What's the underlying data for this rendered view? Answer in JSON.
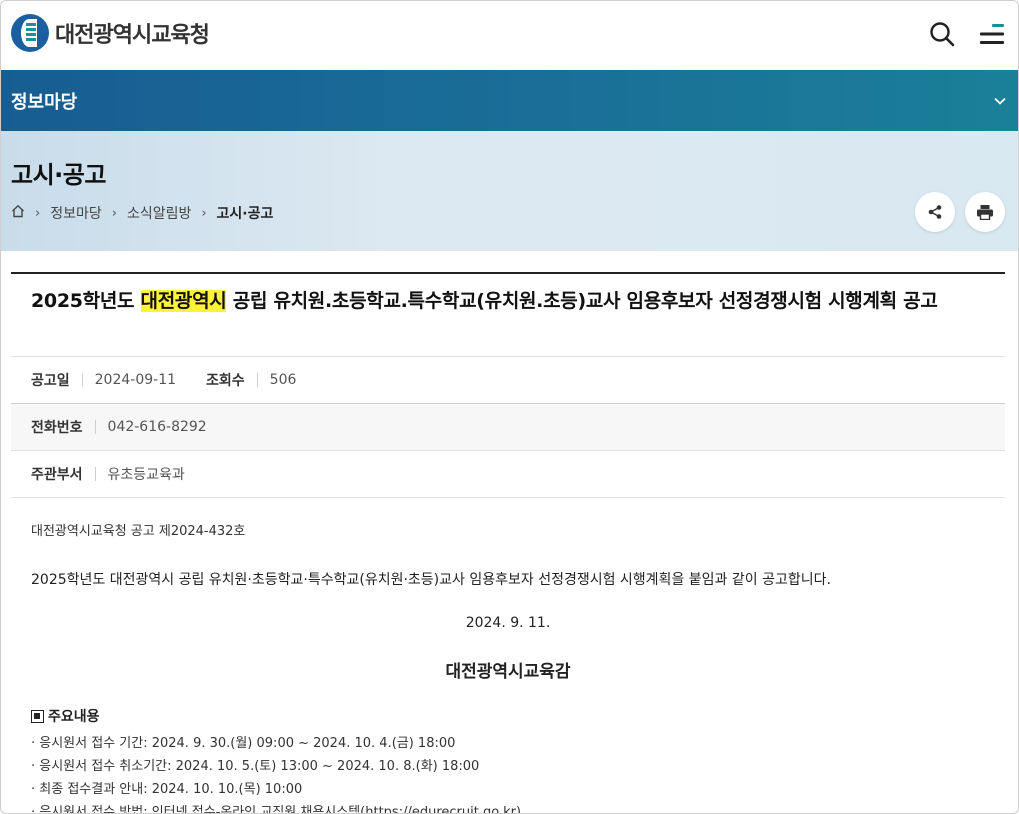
{
  "header": {
    "logo_text": "대전광역시교육청"
  },
  "section": {
    "title": "정보마당"
  },
  "page": {
    "title": "고시·공고",
    "breadcrumb": [
      "정보마당",
      "소식알림방",
      "고시·공고"
    ]
  },
  "post": {
    "title_before": "2025학년도 ",
    "title_highlight": "대전광역시",
    "title_after": " 공립 유치원.초등학교.특수학교(유치원.초등)교사 임용후보자 선정경쟁시험 시행계획 공고",
    "meta": {
      "date_label": "공고일",
      "date_value": "2024-09-11",
      "views_label": "조회수",
      "views_value": "506",
      "phone_label": "전화번호",
      "phone_value": "042-616-8292",
      "dept_label": "주관부서",
      "dept_value": "유초등교육과"
    },
    "body": {
      "notice_no": "대전광역시교육청 공고 제2024-432호",
      "intro": "2025학년도 대전광역시 공립 유치원·초등학교·특수학교(유치원·초등)교사 임용후보자 선정경쟁시험 시행계획을 붙임과 같이 공고합니다.",
      "date": "2024. 9. 11.",
      "issuer": "대전광역시교육감",
      "subhead": "주요내용",
      "items": [
        "· 응시원서 접수 기간: 2024. 9. 30.(월) 09:00 ~ 2024. 10. 4.(금) 18:00",
        "· 응시원서 접수 취소기간: 2024. 10. 5.(토) 13:00 ~ 2024. 10. 8.(화) 18:00",
        "· 최종 접수결과 안내: 2024. 10. 10.(목) 10:00"
      ],
      "method_prefix": "· 응시원서 접수 방법: 인터넷 접수-온라인 교직원 채용시스템(",
      "method_link": "https://edurecruit.go.kr)"
    }
  },
  "colors": {
    "section_bar": "#175d92",
    "page_head_bg": "#d6e5ef",
    "highlight": "#fff23a"
  }
}
